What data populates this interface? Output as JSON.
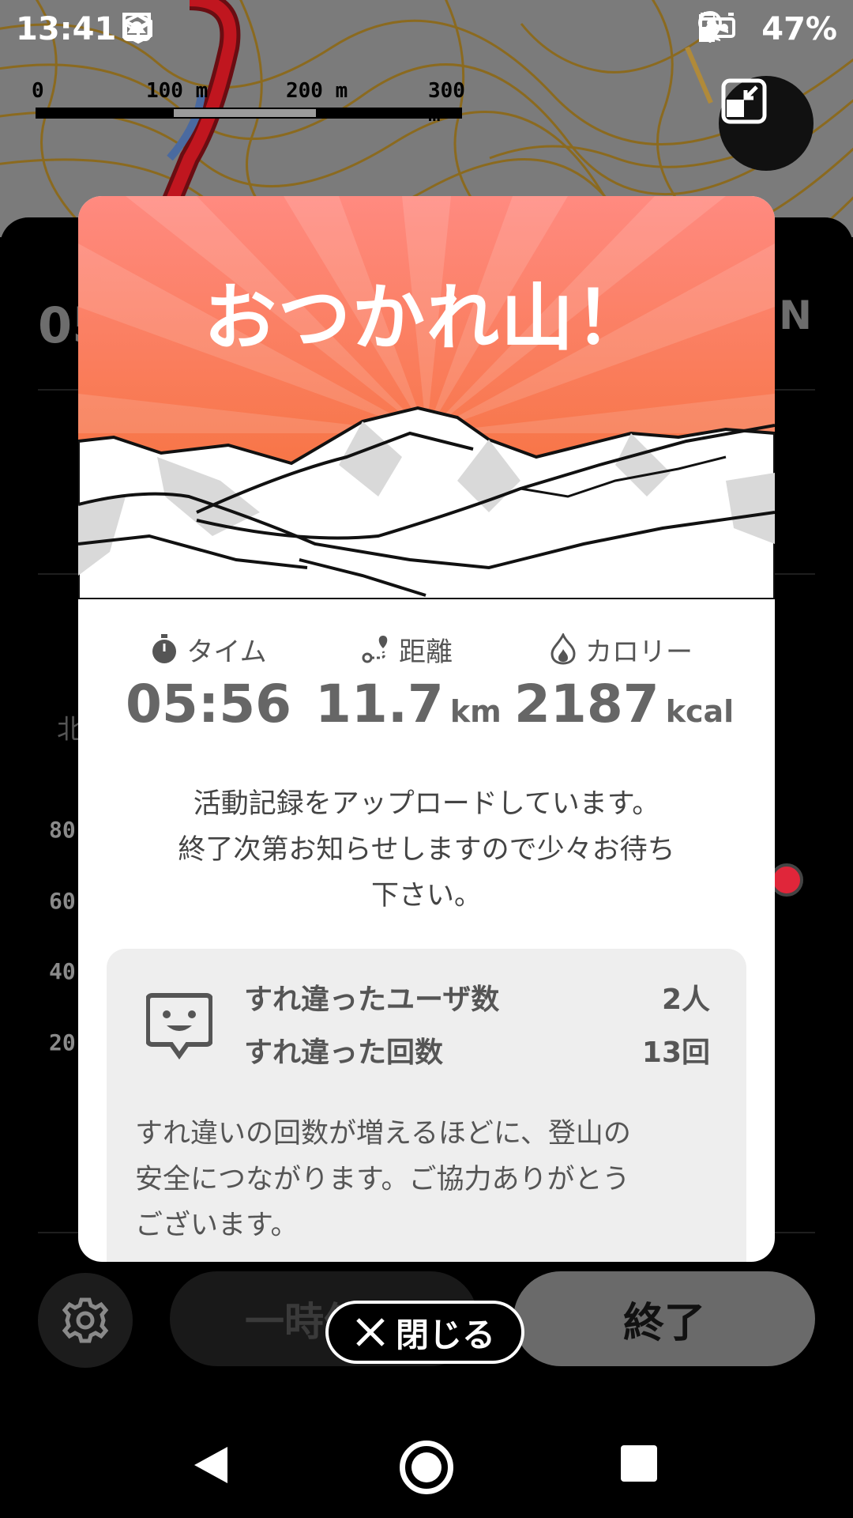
{
  "status_bar": {
    "time": "13:41",
    "battery": "47%",
    "left_icons": [
      "image-icon",
      "package-icon",
      "screen-record-icon",
      "mail-icon"
    ],
    "right_icons": [
      "location-icon",
      "vr-icon",
      "airplane-icon",
      "battery-icon"
    ]
  },
  "map": {
    "scale_labels": [
      "0",
      "100 m",
      "200 m",
      "300 m"
    ],
    "colors": {
      "background": "#7b7b7b",
      "contour": "#8b6a1f",
      "route": "#c0161f"
    }
  },
  "background": {
    "big_value": "05",
    "north_label": "N",
    "north_prefix": "北",
    "y_ticks": [
      "80",
      "60",
      "40",
      "20"
    ]
  },
  "bottom_bar": {
    "pause_label": "一時停止",
    "end_label": "終了",
    "close_label": "閉じる"
  },
  "modal": {
    "title": "おつかれ山！",
    "stats": [
      {
        "label": "タイム",
        "icon": "stopwatch-icon",
        "value": "05:56",
        "unit": ""
      },
      {
        "label": "距離",
        "icon": "route-icon",
        "value": "11.7",
        "unit": "km"
      },
      {
        "label": "カロリー",
        "icon": "flame-icon",
        "value": "2187",
        "unit": "kcal"
      }
    ],
    "upload_message": [
      "活動記録をアップロードしています。",
      "終了次第お知らせしますので少々お待ち",
      "下さい。"
    ],
    "pass_card": {
      "rows": [
        {
          "label": "すれ違ったユーザ数",
          "value": "2人"
        },
        {
          "label": "すれ違った回数",
          "value": "13回"
        }
      ],
      "note": [
        "すれ違いの回数が増えるほどに、登山の",
        "安全につながります。ご協力ありがとう",
        "ございます。"
      ]
    },
    "colors": {
      "hero_top": "#ff8a80",
      "hero_bottom": "#f36b2a",
      "text": "#555555",
      "card": "#eeeeee"
    }
  }
}
